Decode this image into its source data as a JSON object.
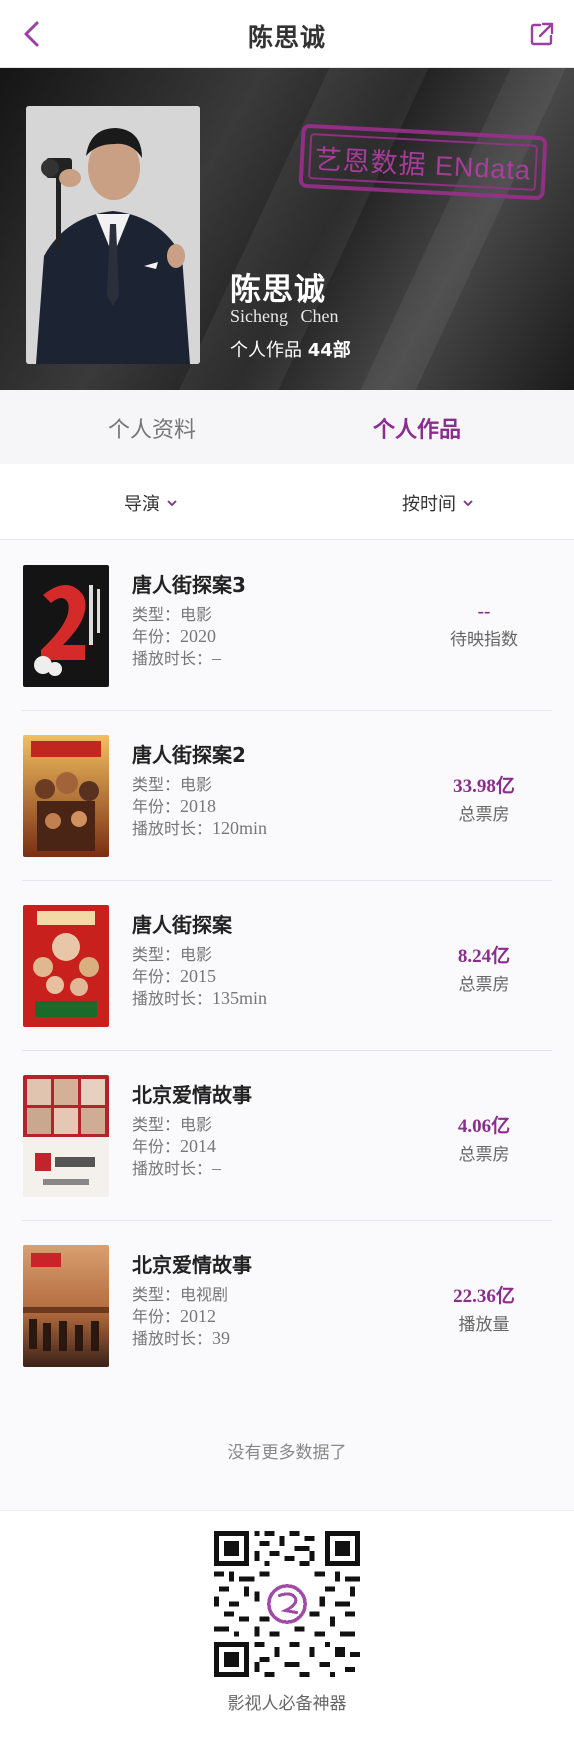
{
  "nav": {
    "title": "陈思诚",
    "back_icon": "chevron-left-icon",
    "share_icon": "share-external-icon",
    "accent": "#9b3fa3"
  },
  "hero": {
    "name_cn": "陈思诚",
    "name_en": "Sicheng  Chen",
    "works_label": "个人作品",
    "works_count": "44部",
    "watermark": "艺恩数据 ENdata",
    "watermark_color": "#9a2f8c"
  },
  "tabs": [
    {
      "label": "个人资料",
      "active": false
    },
    {
      "label": "个人作品",
      "active": true
    }
  ],
  "filters": {
    "role": "导演",
    "sort": "按时间"
  },
  "list": {
    "type_label": "类型：",
    "year_label": "年份：",
    "duration_label": "播放时长：",
    "items": [
      {
        "title": "唐人街探案3",
        "type": "电影",
        "year": "2020",
        "duration": "–",
        "stat_value": "--",
        "stat_label": "待映指数"
      },
      {
        "title": "唐人街探案2",
        "type": "电影",
        "year": "2018",
        "duration": "120min",
        "stat_value": "33.98亿",
        "stat_label": "总票房"
      },
      {
        "title": "唐人街探案",
        "type": "电影",
        "year": "2015",
        "duration": "135min",
        "stat_value": "8.24亿",
        "stat_label": "总票房"
      },
      {
        "title": "北京爱情故事",
        "type": "电影",
        "year": "2014",
        "duration": "–",
        "stat_value": "4.06亿",
        "stat_label": "总票房"
      },
      {
        "title": "北京爱情故事",
        "type": "电视剧",
        "year": "2012",
        "duration": "39",
        "stat_value": "22.36亿",
        "stat_label": "播放量"
      }
    ],
    "no_more": "没有更多数据了"
  },
  "footer": {
    "caption": "影视人必备神器"
  },
  "colors": {
    "accent_purple": "#8a2d8c",
    "background": "#fafafc"
  }
}
